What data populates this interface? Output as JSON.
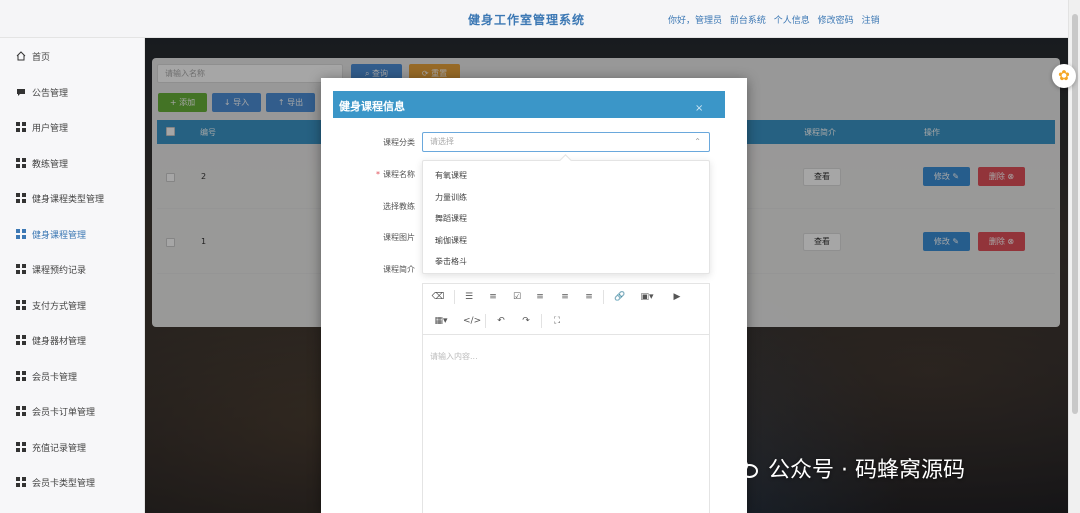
{
  "header": {
    "title": "健身工作室管理系统",
    "links": [
      "你好，管理员",
      "前台系统",
      "个人信息",
      "修改密码",
      "注销"
    ]
  },
  "sidebar": {
    "items": [
      {
        "label": "首页",
        "icon": "home-icon"
      },
      {
        "label": "公告管理",
        "icon": "notice-icon"
      },
      {
        "label": "用户管理",
        "icon": "grid-icon"
      },
      {
        "label": "教练管理",
        "icon": "grid-icon"
      },
      {
        "label": "健身课程类型管理",
        "icon": "grid-icon"
      },
      {
        "label": "健身课程管理",
        "icon": "grid-icon",
        "active": true
      },
      {
        "label": "课程预约记录",
        "icon": "grid-icon"
      },
      {
        "label": "支付方式管理",
        "icon": "grid-icon"
      },
      {
        "label": "健身器材管理",
        "icon": "grid-icon"
      },
      {
        "label": "会员卡管理",
        "icon": "grid-icon"
      },
      {
        "label": "会员卡订单管理",
        "icon": "grid-icon"
      },
      {
        "label": "充值记录管理",
        "icon": "grid-icon"
      },
      {
        "label": "会员卡类型管理",
        "icon": "grid-icon"
      }
    ]
  },
  "toolbar": {
    "search_placeholder": "请输入名称",
    "query_label": "查询",
    "reset_label": "重置",
    "add_label": "添加",
    "import_label": "导入",
    "export_label": "导出"
  },
  "table": {
    "columns": [
      "编号",
      "课程简介",
      "操作"
    ],
    "rows": [
      {
        "no": "2",
        "view": "查看",
        "edit": "修改",
        "delete": "删除"
      },
      {
        "no": "1",
        "view": "查看",
        "edit": "修改",
        "delete": "删除"
      }
    ]
  },
  "dialog": {
    "title": "健身课程信息",
    "close": "×",
    "fields": {
      "category_label": "课程分类",
      "category_placeholder": "请选择",
      "name_label": "课程名称",
      "coach_label": "选择教练",
      "image_label": "课程图片",
      "intro_label": "课程简介"
    },
    "category_options": [
      "有氧课程",
      "力量训练",
      "舞蹈课程",
      "瑜伽课程",
      "拳击格斗"
    ],
    "editor_placeholder": "请输入内容..."
  },
  "watermark": "公众号 · 码蜂窝源码",
  "colors": {
    "primary": "#3b96c8",
    "danger": "#e0505a",
    "success": "#67b13a",
    "warning": "#e8a33d"
  }
}
